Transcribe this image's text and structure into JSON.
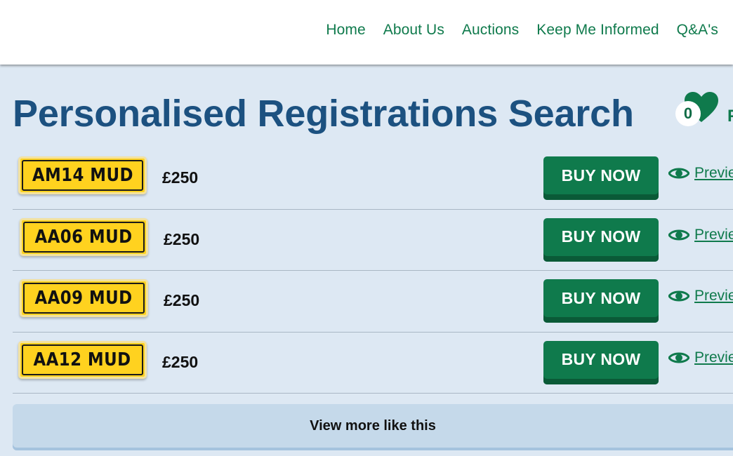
{
  "nav": {
    "items": [
      {
        "label": "Home"
      },
      {
        "label": "About Us"
      },
      {
        "label": "Auctions"
      },
      {
        "label": "Keep Me Informed"
      },
      {
        "label": "Q&A's"
      }
    ]
  },
  "page": {
    "title": "Personalised Registrations Search"
  },
  "favourites": {
    "count": "0",
    "label_partial": "F W",
    "icon": "heart-icon"
  },
  "results": [
    {
      "plate": "AM14 MUD",
      "price": "£250",
      "buy_label": "BUY NOW",
      "preview_label": "Previe"
    },
    {
      "plate": "AA06 MUD",
      "price": "£250",
      "buy_label": "BUY NOW",
      "preview_label": "Previe"
    },
    {
      "plate": "AA09 MUD",
      "price": "£250",
      "buy_label": "BUY NOW",
      "preview_label": "Previe"
    },
    {
      "plate": "AA12 MUD",
      "price": "£250",
      "buy_label": "BUY NOW",
      "preview_label": "Previe"
    }
  ],
  "view_more": {
    "label": "View more like this"
  },
  "colors": {
    "brand_green": "#0f7a4c",
    "title_blue": "#1c5180",
    "page_bg": "#dde8f3",
    "plate_yellow": "#ffd21f"
  }
}
